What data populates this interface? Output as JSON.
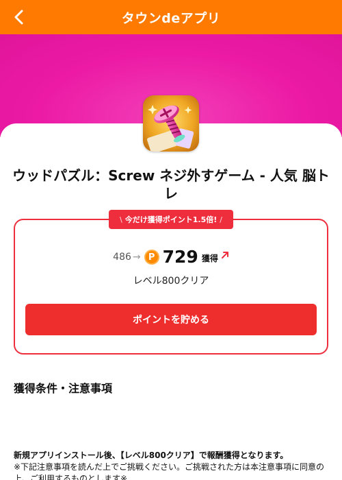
{
  "header": {
    "title": "タウンdeアプリ",
    "back_icon": "chevron-left-icon",
    "bg_color": "#ff7a00"
  },
  "hero": {
    "bg_color": "#ec1aa5"
  },
  "app": {
    "title": "ウッドパズル：Screw ネジ外すゲーム - 人気 脳トレ",
    "icon": "screw-app-icon"
  },
  "reward": {
    "promo_badge": "今だけ獲得ポイント1.5倍!",
    "promo_left_mark": "\\",
    "promo_right_mark": "/",
    "old_points": "486",
    "arrow": "→",
    "coin_letter": "P",
    "new_points": "729",
    "earn_label": "獲得",
    "condition": "レベル800クリア",
    "cta_label": "ポイントを貯める",
    "accent_color": "#ee2d3d"
  },
  "details": {
    "heading": "獲得条件・注意事項",
    "note_line1": "新規アプリインストール後、【レベル800クリア】で報酬獲得となります。",
    "note_line2": "※下記注意事項を読んだ上でご挑戦ください。ご挑戦された方は本注意事項に同意の上、ご利用するものとします※"
  }
}
